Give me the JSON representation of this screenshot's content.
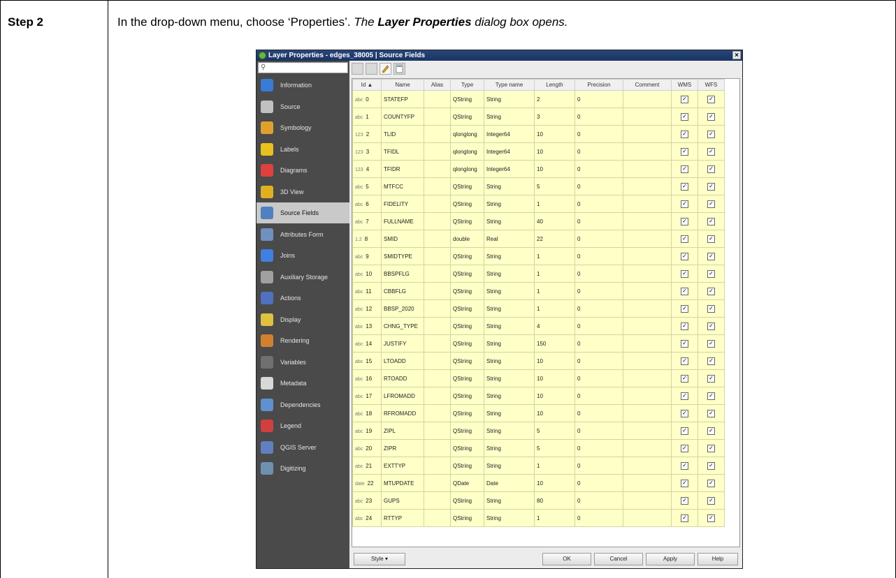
{
  "step": {
    "label": "Step 2",
    "instruction_plain": "In the drop-down menu, choose ‘Properties’. ",
    "instruction_em_1": "The ",
    "instruction_strong": "Layer Properties",
    "instruction_em_2": " dialog box opens."
  },
  "dialog": {
    "title": "Layer Properties - edges_38005 | Source Fields",
    "close_label": "×",
    "search_placeholder": ""
  },
  "sidebar": {
    "items": [
      {
        "label": "Information",
        "icon": "info-icon",
        "color": "#3a7bd5"
      },
      {
        "label": "Source",
        "icon": "source-icon",
        "color": "#c0c0c0"
      },
      {
        "label": "Symbology",
        "icon": "symbology-icon",
        "color": "#e0a030"
      },
      {
        "label": "Labels",
        "icon": "labels-icon",
        "color": "#e8c020"
      },
      {
        "label": "Diagrams",
        "icon": "diagrams-icon",
        "color": "#e04040"
      },
      {
        "label": "3D View",
        "icon": "3d-view-icon",
        "color": "#e0b020"
      },
      {
        "label": "Source Fields",
        "icon": "source-fields-icon",
        "color": "#5080c0"
      },
      {
        "label": "Attributes Form",
        "icon": "attributes-form-icon",
        "color": "#7090c0"
      },
      {
        "label": "Joins",
        "icon": "joins-icon",
        "color": "#4080e0"
      },
      {
        "label": "Auxiliary Storage",
        "icon": "auxiliary-storage-icon",
        "color": "#a0a0a0"
      },
      {
        "label": "Actions",
        "icon": "actions-icon",
        "color": "#5070c0"
      },
      {
        "label": "Display",
        "icon": "display-icon",
        "color": "#e0c040"
      },
      {
        "label": "Rendering",
        "icon": "rendering-icon",
        "color": "#d08030"
      },
      {
        "label": "Variables",
        "icon": "variables-icon",
        "color": "#707070"
      },
      {
        "label": "Metadata",
        "icon": "metadata-icon",
        "color": "#d8d8d8"
      },
      {
        "label": "Dependencies",
        "icon": "dependencies-icon",
        "color": "#6090d0"
      },
      {
        "label": "Legend",
        "icon": "legend-icon",
        "color": "#d04040"
      },
      {
        "label": "QGIS Server",
        "icon": "qgis-server-icon",
        "color": "#6080c0"
      },
      {
        "label": "Digitizing",
        "icon": "digitizing-icon",
        "color": "#7090b0"
      }
    ],
    "active_index": 6
  },
  "table": {
    "headers": [
      "Id ▲",
      "Name",
      "Alias",
      "Type",
      "Type name",
      "Length",
      "Precision",
      "Comment",
      "WMS",
      "WFS"
    ],
    "check_glyph": "✓",
    "rows": [
      {
        "icon": "abc",
        "id": "0",
        "name": "STATEFP",
        "alias": "",
        "type": "QString",
        "type_name": "String",
        "length": "2",
        "precision": "0",
        "comment": ""
      },
      {
        "icon": "abc",
        "id": "1",
        "name": "COUNTYFP",
        "alias": "",
        "type": "QString",
        "type_name": "String",
        "length": "3",
        "precision": "0",
        "comment": ""
      },
      {
        "icon": "123",
        "id": "2",
        "name": "TLID",
        "alias": "",
        "type": "qlonglong",
        "type_name": "Integer64",
        "length": "10",
        "precision": "0",
        "comment": ""
      },
      {
        "icon": "123",
        "id": "3",
        "name": "TFIDL",
        "alias": "",
        "type": "qlonglong",
        "type_name": "Integer64",
        "length": "10",
        "precision": "0",
        "comment": ""
      },
      {
        "icon": "123",
        "id": "4",
        "name": "TFIDR",
        "alias": "",
        "type": "qlonglong",
        "type_name": "Integer64",
        "length": "10",
        "precision": "0",
        "comment": ""
      },
      {
        "icon": "abc",
        "id": "5",
        "name": "MTFCC",
        "alias": "",
        "type": "QString",
        "type_name": "String",
        "length": "5",
        "precision": "0",
        "comment": ""
      },
      {
        "icon": "abc",
        "id": "6",
        "name": "FIDELITY",
        "alias": "",
        "type": "QString",
        "type_name": "String",
        "length": "1",
        "precision": "0",
        "comment": ""
      },
      {
        "icon": "abc",
        "id": "7",
        "name": "FULLNAME",
        "alias": "",
        "type": "QString",
        "type_name": "String",
        "length": "40",
        "precision": "0",
        "comment": ""
      },
      {
        "icon": "1.2",
        "id": "8",
        "name": "SMID",
        "alias": "",
        "type": "double",
        "type_name": "Real",
        "length": "22",
        "precision": "0",
        "comment": ""
      },
      {
        "icon": "abc",
        "id": "9",
        "name": "SMIDTYPE",
        "alias": "",
        "type": "QString",
        "type_name": "String",
        "length": "1",
        "precision": "0",
        "comment": ""
      },
      {
        "icon": "abc",
        "id": "10",
        "name": "BBSPFLG",
        "alias": "",
        "type": "QString",
        "type_name": "String",
        "length": "1",
        "precision": "0",
        "comment": ""
      },
      {
        "icon": "abc",
        "id": "11",
        "name": "CBBFLG",
        "alias": "",
        "type": "QString",
        "type_name": "String",
        "length": "1",
        "precision": "0",
        "comment": ""
      },
      {
        "icon": "abc",
        "id": "12",
        "name": "BBSP_2020",
        "alias": "",
        "type": "QString",
        "type_name": "String",
        "length": "1",
        "precision": "0",
        "comment": ""
      },
      {
        "icon": "abc",
        "id": "13",
        "name": "CHNG_TYPE",
        "alias": "",
        "type": "QString",
        "type_name": "String",
        "length": "4",
        "precision": "0",
        "comment": ""
      },
      {
        "icon": "abc",
        "id": "14",
        "name": "JUSTIFY",
        "alias": "",
        "type": "QString",
        "type_name": "String",
        "length": "150",
        "precision": "0",
        "comment": ""
      },
      {
        "icon": "abc",
        "id": "15",
        "name": "LTOADD",
        "alias": "",
        "type": "QString",
        "type_name": "String",
        "length": "10",
        "precision": "0",
        "comment": ""
      },
      {
        "icon": "abc",
        "id": "16",
        "name": "RTOADD",
        "alias": "",
        "type": "QString",
        "type_name": "String",
        "length": "10",
        "precision": "0",
        "comment": ""
      },
      {
        "icon": "abc",
        "id": "17",
        "name": "LFROMADD",
        "alias": "",
        "type": "QString",
        "type_name": "String",
        "length": "10",
        "precision": "0",
        "comment": ""
      },
      {
        "icon": "abc",
        "id": "18",
        "name": "RFROMADD",
        "alias": "",
        "type": "QString",
        "type_name": "String",
        "length": "10",
        "precision": "0",
        "comment": ""
      },
      {
        "icon": "abc",
        "id": "19",
        "name": "ZIPL",
        "alias": "",
        "type": "QString",
        "type_name": "String",
        "length": "5",
        "precision": "0",
        "comment": ""
      },
      {
        "icon": "abc",
        "id": "20",
        "name": "ZIPR",
        "alias": "",
        "type": "QString",
        "type_name": "String",
        "length": "5",
        "precision": "0",
        "comment": ""
      },
      {
        "icon": "abc",
        "id": "21",
        "name": "EXTTYP",
        "alias": "",
        "type": "QString",
        "type_name": "String",
        "length": "1",
        "precision": "0",
        "comment": ""
      },
      {
        "icon": "date",
        "id": "22",
        "name": "MTUPDATE",
        "alias": "",
        "type": "QDate",
        "type_name": "Date",
        "length": "10",
        "precision": "0",
        "comment": ""
      },
      {
        "icon": "abc",
        "id": "23",
        "name": "GUPS",
        "alias": "",
        "type": "QString",
        "type_name": "String",
        "length": "80",
        "precision": "0",
        "comment": ""
      },
      {
        "icon": "abc",
        "id": "24",
        "name": "RTTYP",
        "alias": "",
        "type": "QString",
        "type_name": "String",
        "length": "1",
        "precision": "0",
        "comment": ""
      }
    ]
  },
  "buttons": {
    "style": "Style",
    "style_arrow": "▾",
    "ok": "OK",
    "cancel": "Cancel",
    "apply": "Apply",
    "help": "Help"
  },
  "colors": {
    "field_bg": "#ffffc8",
    "sidebar_bg": "#4a4a4a",
    "titlebar": "#1a3363"
  }
}
